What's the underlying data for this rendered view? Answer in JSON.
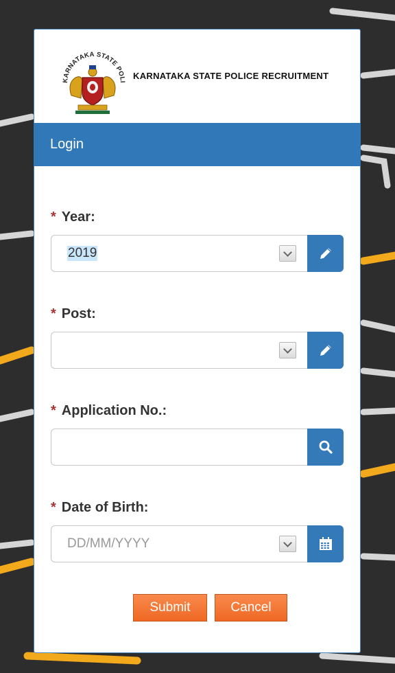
{
  "brand": {
    "title": "KARNATAKA STATE POLICE RECRUITMENT",
    "emblem_arc_text": "KARNATAKA STATE POLICE"
  },
  "login": {
    "heading": "Login"
  },
  "fields": {
    "year": {
      "label": "Year:",
      "required_mark": "*",
      "value": "2019",
      "button_icon": "pencil-icon"
    },
    "post": {
      "label": "Post:",
      "required_mark": "*",
      "value": "",
      "button_icon": "pencil-icon"
    },
    "application_no": {
      "label": "Application No.:",
      "required_mark": "*",
      "value": "",
      "button_icon": "search-icon"
    },
    "dob": {
      "label": "Date of Birth:",
      "required_mark": "*",
      "placeholder": "DD/MM/YYYY",
      "button_icon": "calendar-icon"
    }
  },
  "actions": {
    "submit": "Submit",
    "cancel": "Cancel"
  },
  "colors": {
    "accent_blue": "#3178b9",
    "button_orange": "#f26f2b",
    "required_red": "#aa3333",
    "card_border": "#4a88c4"
  }
}
